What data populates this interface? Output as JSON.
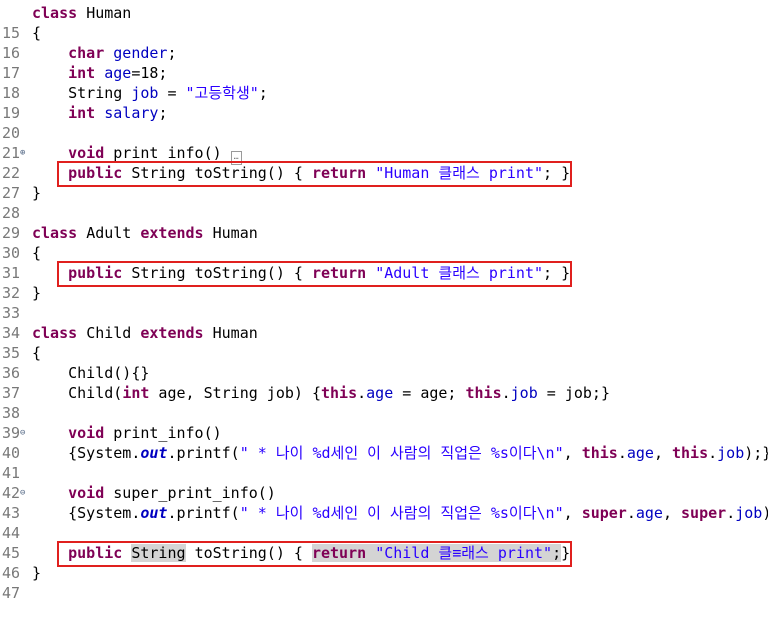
{
  "editor": {
    "line_numbers": [
      "15",
      "16",
      "17",
      "18",
      "19",
      "20",
      "21",
      "22",
      "27",
      "28",
      "29",
      "30",
      "31",
      "32",
      "33",
      "34",
      "35",
      "36",
      "37",
      "38",
      "39",
      "40",
      "41",
      "42",
      "43",
      "44",
      "45",
      "46",
      "47"
    ],
    "fold_markers": {
      "expand": "⊕",
      "collapse": "⊖",
      "collapsed_body": "…"
    },
    "tokens": {
      "class": "class",
      "human": "Human",
      "open_brace": "{",
      "close_brace": "}",
      "char": "char",
      "gender_field": "gender",
      "semicolon": ";",
      "int": "int",
      "age_field": "age",
      "age_init": "=18;",
      "string_type": "String",
      "job_field": "job",
      "eq": " = ",
      "job_value": "\"고등학생\"",
      "salary_field": "salary",
      "void": "void",
      "print_info_sig": "print_info()",
      "public": "public",
      "tostring_sig": "toString() {",
      "return": "return",
      "human_str": "\"Human 클래스 print\"",
      "stmt_end": "; }",
      "adult": "Adult",
      "extends": "extends",
      "adult_str": "\"Adult 클래스 print\"",
      "child": "Child",
      "child_ctor_empty": "Child(){}",
      "child_ctor_open": "Child(",
      "age_param": " age, ",
      "job_param_end": " job) {",
      "this": "this",
      "dot": ".",
      "assign_age": " = age; ",
      "assign_job": " = job;}",
      "sysout_open": "{System.",
      "out": "out",
      "printf_open": ".printf(",
      "printf_str": "\" * 나이 %d세인 이 사람의 직업은 %s이다\\n\"",
      "comma": ", ",
      "job_end": ");}",
      "super_print_info_sig": "super_print_info()",
      "super": "super",
      "child_str": "\"Child 클≡래스 print\"",
      "child_stmt_end": ";}"
    }
  }
}
